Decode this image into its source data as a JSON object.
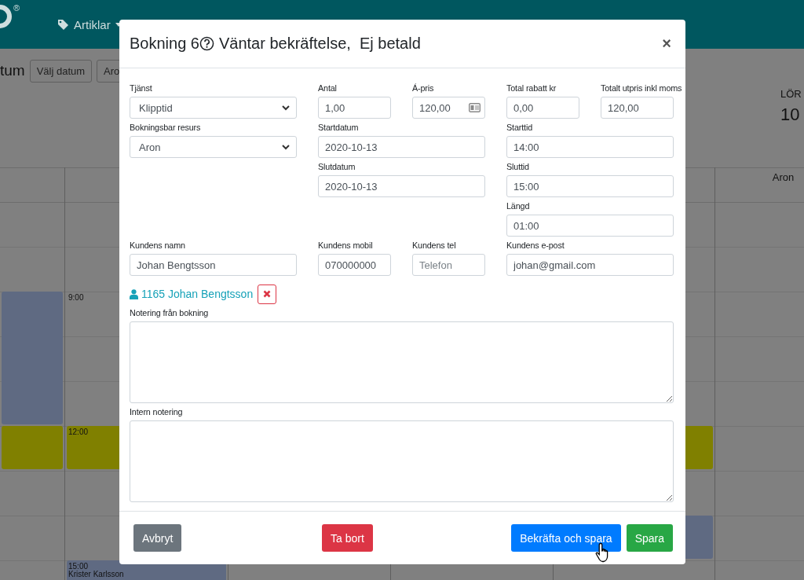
{
  "nav": {
    "logo_mark": "®",
    "items": [
      {
        "label": "Artiklar"
      }
    ]
  },
  "toolbar": {
    "heading": "tum",
    "buttons": [
      "Välj datum",
      "Aro"
    ]
  },
  "day_header": {
    "weekday": "LÖR",
    "day": "10"
  },
  "calendar": {
    "columns": [
      {
        "events": [
          {
            "kind": "booking",
            "color": "#5f6a82"
          },
          {
            "kind": "booking",
            "color": "#808000"
          }
        ]
      },
      {
        "events": [
          {
            "kind": "slot",
            "time": "9:00"
          },
          {
            "kind": "booking",
            "color": "#808000",
            "time": "12:00"
          },
          {
            "kind": "booking",
            "color": "#5f6a82",
            "time": "15:00",
            "title": "Krister Karlsson"
          }
        ]
      },
      {},
      {},
      {
        "events": [
          {
            "kind": "booking",
            "color": "#808000"
          },
          {
            "kind": "booking",
            "color": "#5f6a82"
          }
        ]
      },
      {
        "header": "Aron"
      }
    ]
  },
  "modal": {
    "title": "Bokning 6",
    "status": "Väntar bekräftelse,  Ej betald",
    "close": "×",
    "fields": [
      {
        "label": "Tjänst",
        "kind": "select",
        "value": "Klipptid"
      },
      {
        "label": "Antal",
        "kind": "text",
        "value": "1,00"
      },
      {
        "label": "Á-pris",
        "kind": "text_icon",
        "value": "120,00"
      },
      {
        "label": "Total rabatt kr",
        "kind": "text",
        "value": "0,00"
      },
      {
        "label": "Totalt utpris inkl moms",
        "kind": "text",
        "value": "120,00"
      },
      {
        "label": "Bokningsbar resurs",
        "kind": "select",
        "value": "Aron"
      },
      {
        "label": "Startdatum",
        "kind": "text",
        "value": "2020-10-13"
      },
      {
        "label": "Starttid",
        "kind": "text",
        "value": "14:00"
      },
      {
        "label": "Slutdatum",
        "kind": "text",
        "value": "2020-10-13"
      },
      {
        "label": "Sluttid",
        "kind": "text",
        "value": "15:00"
      },
      {
        "label": "Längd",
        "kind": "text",
        "value": "01:00"
      },
      {
        "label": "Kundens namn",
        "kind": "text",
        "value": "Johan Bengtsson"
      },
      {
        "label": "Kundens mobil",
        "kind": "text",
        "value": "070000000"
      },
      {
        "label": "Kundens tel",
        "kind": "text",
        "placeholder": "Telefon"
      },
      {
        "label": "Kundens e-post",
        "kind": "text",
        "value": "johan@gmail.com"
      }
    ],
    "customer_link": "1165 Johan Bengtsson",
    "notes": [
      {
        "label": "Notering från bokning"
      },
      {
        "label": "Intern notering"
      }
    ],
    "buttons": [
      {
        "label": "Avbryt",
        "kind": "secondary"
      },
      {
        "label": "Ta bort",
        "kind": "danger"
      },
      {
        "label": "Bekräfta och spara",
        "kind": "primary",
        "hovered": true
      },
      {
        "label": "Spara",
        "kind": "success"
      }
    ]
  }
}
